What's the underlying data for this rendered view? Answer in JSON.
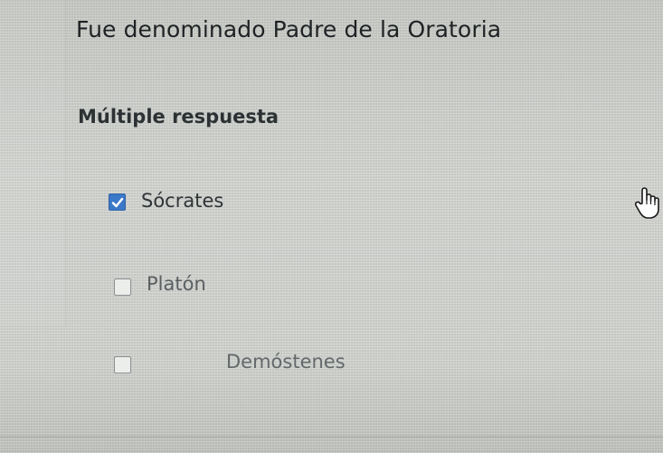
{
  "question": {
    "text": "Fue denominado Padre de la Oratoria"
  },
  "question_type": "Múltiple respuesta",
  "options": [
    {
      "label": "Sócrates",
      "checked": true
    },
    {
      "label": "Platón",
      "checked": false
    },
    {
      "label": "Demóstenes",
      "checked": false
    }
  ],
  "colors": {
    "checkbox_checked": "#3c78c8",
    "text_primary": "#1f2224",
    "background": "#d3d5d1"
  },
  "cursor": {
    "icon": "hand-pointer-icon"
  }
}
